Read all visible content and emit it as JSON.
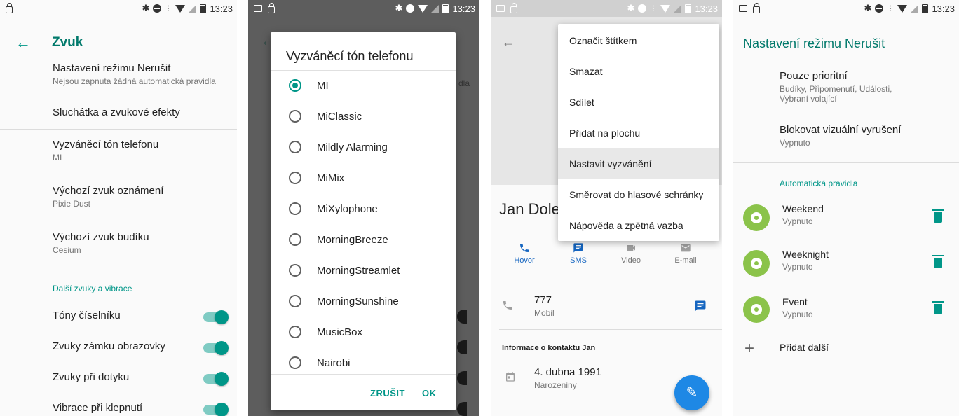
{
  "status": {
    "time": "13:23"
  },
  "screen1": {
    "title": "Zvuk",
    "items": [
      {
        "title": "Nastavení režimu Nerušit",
        "subtitle": "Nejsou zapnuta žádná automatická pravidla"
      },
      {
        "title": "Sluchátka a zvukové efekty",
        "subtitle": ""
      },
      {
        "title": "Vyzváněcí tón telefonu",
        "subtitle": "MI"
      },
      {
        "title": "Výchozí zvuk oznámení",
        "subtitle": "Pixie Dust"
      },
      {
        "title": "Výchozí zvuk budíku",
        "subtitle": "Cesium"
      }
    ],
    "section": "Další zvuky a vibrace",
    "toggles": [
      {
        "label": "Tóny číselníku",
        "on": true
      },
      {
        "label": "Zvuky zámku obrazovky",
        "on": true
      },
      {
        "label": "Zvuky při dotyku",
        "on": true
      },
      {
        "label": "Vibrace při klepnutí",
        "on": true
      }
    ]
  },
  "screen2": {
    "dialog_title": "Vyzváněcí tón telefonu",
    "selected": "MI",
    "ringtones": [
      "MI",
      "MiClassic",
      "Mildly Alarming",
      "MiMix",
      "MiXylophone",
      "MorningBreeze",
      "MorningStreamlet",
      "MorningSunshine",
      "MusicBox",
      "Nairobi"
    ],
    "cancel": "ZRUŠIT",
    "ok": "OK",
    "ghost_text": "dla"
  },
  "screen3": {
    "contact_name": "Jan Dole",
    "menu": [
      "Označit štítkem",
      "Smazat",
      "Sdílet",
      "Přidat na plochu",
      "Nastavit vyzvánění",
      "Směrovat do hlasové schránky",
      "Nápověda a zpětná vazba"
    ],
    "highlighted_menu": "Nastavit vyzvánění",
    "actions": [
      {
        "label": "Hovor",
        "icon": "phone-icon"
      },
      {
        "label": "SMS",
        "icon": "message-icon"
      },
      {
        "label": "Video",
        "icon": "video-icon"
      },
      {
        "label": "E-mail",
        "icon": "email-icon"
      }
    ],
    "phone": {
      "number": "777",
      "type": "Mobil"
    },
    "info_header": "Informace o kontaktu Jan",
    "birthday": {
      "date": "4. dubna 1991",
      "label": "Narozeniny"
    }
  },
  "screen4": {
    "title": "Nastavení režimu Nerušit",
    "items": [
      {
        "title": "Pouze prioritní",
        "subtitle": "Budíky, Připomenutí, Události, Vybraní volající"
      },
      {
        "title": "Blokovat vizuální vyrušení",
        "subtitle": "Vypnuto"
      }
    ],
    "section": "Automatická pravidla",
    "rules": [
      {
        "name": "Weekend",
        "state": "Vypnuto"
      },
      {
        "name": "Weeknight",
        "state": "Vypnuto"
      },
      {
        "name": "Event",
        "state": "Vypnuto"
      }
    ],
    "add_more": "Přidat další"
  },
  "colors": {
    "accent": "#009688",
    "link_blue": "#1565c0",
    "fab": "#1e88e5",
    "gear": "#8bc34a"
  }
}
